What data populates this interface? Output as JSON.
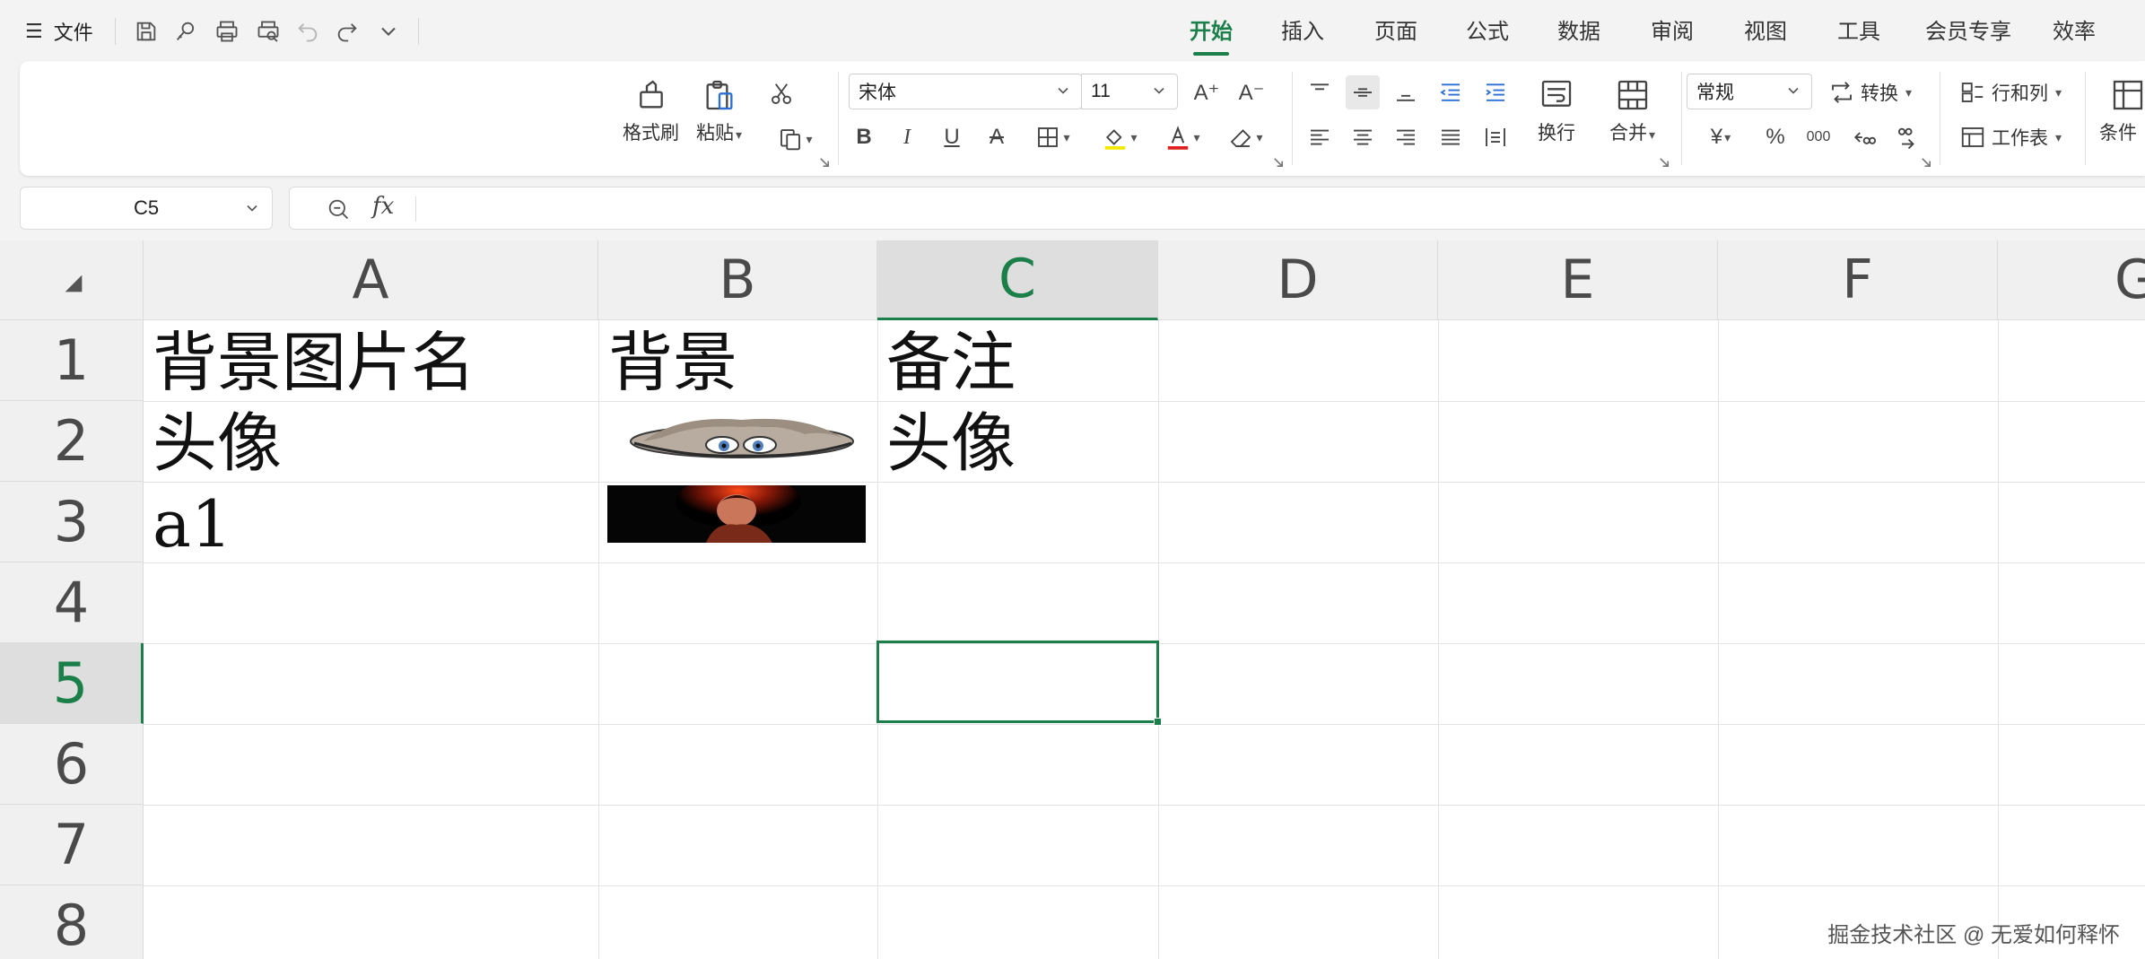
{
  "menubar": {
    "file_label": "文件",
    "tabs": [
      "开始",
      "插入",
      "页面",
      "公式",
      "数据",
      "审阅",
      "视图",
      "工具",
      "会员专享",
      "效率"
    ],
    "active_tab": "开始"
  },
  "ribbon": {
    "format_painter": "格式刷",
    "paste": "粘贴",
    "font_name": "宋体",
    "font_size": "11",
    "wrap": "换行",
    "merge": "合并",
    "number_format": "常规",
    "convert": "转换",
    "rows_cols": "行和列",
    "worksheet": "工作表",
    "conditional": "条件",
    "increase_font_icon": "A⁺",
    "decrease_font_icon": "A⁻",
    "currency_symbol": "¥",
    "percent_symbol": "%",
    "thousands_symbol": "000"
  },
  "formula_bar": {
    "name_box": "C5",
    "fx": "fx",
    "formula": ""
  },
  "sheet": {
    "columns": [
      "A",
      "B",
      "C",
      "D",
      "E",
      "F",
      "G"
    ],
    "selected_column": "C",
    "rows": [
      "1",
      "2",
      "3",
      "4",
      "5",
      "6",
      "7",
      "8"
    ],
    "selected_row": "5",
    "selected_cell": "C5",
    "cells": {
      "A1": "背景图片名",
      "B1": "背景",
      "C1": "备注",
      "A2": "头像",
      "C2": "头像",
      "A3": "a1"
    },
    "images": {
      "B2": "avatar-cartoon-image",
      "B3": "dark-red-portrait-image"
    }
  },
  "watermark": "掘金技术社区 @ 无爱如何释怀",
  "colors": {
    "accent": "#1b7f4a",
    "header_bg": "#f0f0f0",
    "selected_header_bg": "#dedede"
  }
}
